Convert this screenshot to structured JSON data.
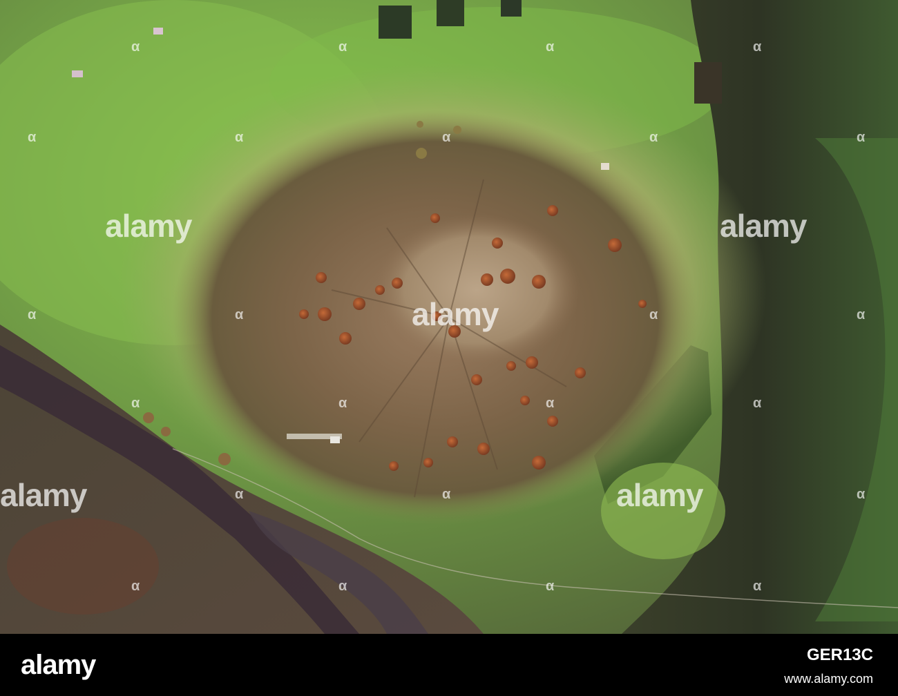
{
  "image": {
    "subject": "satellite view of a volcanic massif with scattered cinder cones",
    "palette": {
      "grassland": "#78a94a",
      "lush_green": "#8cc650",
      "summit_brown": "#8a6e52",
      "caldera_tan": "#b0987a",
      "cone_red": "#a4552c",
      "lava_dark": "#3e2f34",
      "forest_dark": "#2e3a22"
    }
  },
  "watermark": {
    "text": "alamy",
    "icon": "alamy-logo-watermark"
  },
  "footer": {
    "logo_text": "alamy",
    "image_id": "GER13C",
    "url": "www.alamy.com",
    "background": "#000000"
  }
}
